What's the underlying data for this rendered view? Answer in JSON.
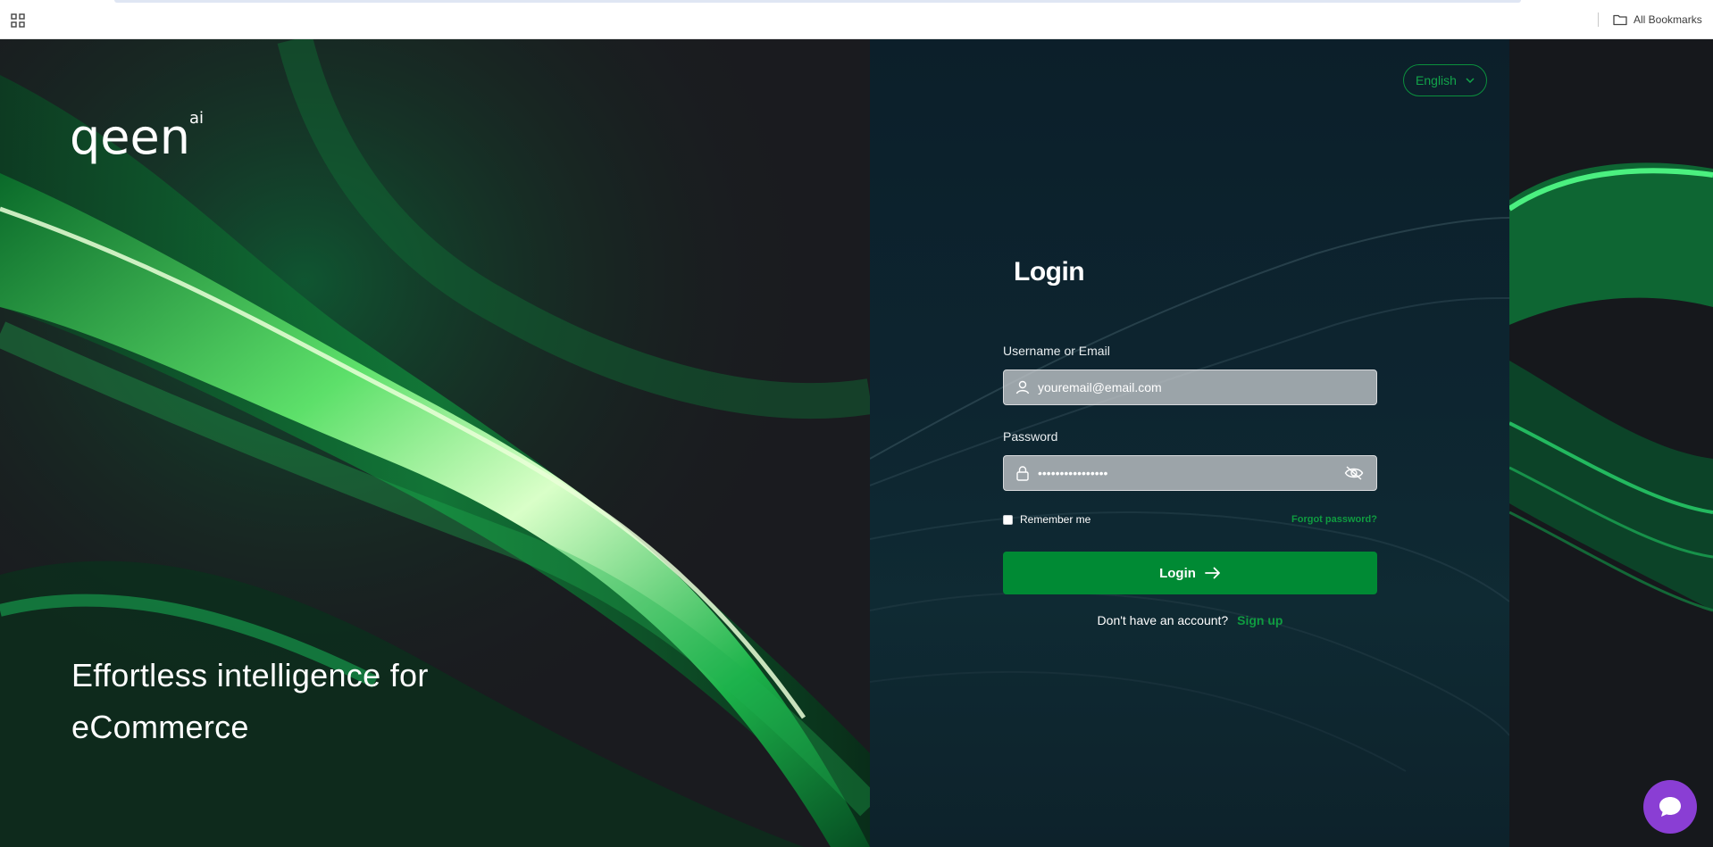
{
  "browser": {
    "all_bookmarks_label": "All Bookmarks"
  },
  "brand": {
    "logo_text": "qeen",
    "logo_superscript": "ai"
  },
  "hero": {
    "tagline_line1": "Effortless intelligence for",
    "tagline_line2": "eCommerce"
  },
  "language": {
    "selected": "English"
  },
  "login": {
    "title": "Login",
    "username_label": "Username or Email",
    "username_value": "youremail@email.com",
    "password_label": "Password",
    "password_masked": "••••••••••••••••",
    "remember_me": "Remember me",
    "forgot_password": "Forgot password?",
    "submit_label": "Login",
    "no_account_text": "Don't have an account?",
    "signup_link": "Sign up"
  },
  "colors": {
    "accent_green": "#008a34",
    "link_green": "#0f9b40",
    "panel_bg": "#0d2530",
    "chat_purple": "#8a3ed4"
  },
  "icons": [
    "apps-grid-icon",
    "folder-icon",
    "chevron-down-icon",
    "user-icon",
    "lock-icon",
    "eye-slash-icon",
    "arrow-right-icon",
    "chat-bubble-icon"
  ]
}
